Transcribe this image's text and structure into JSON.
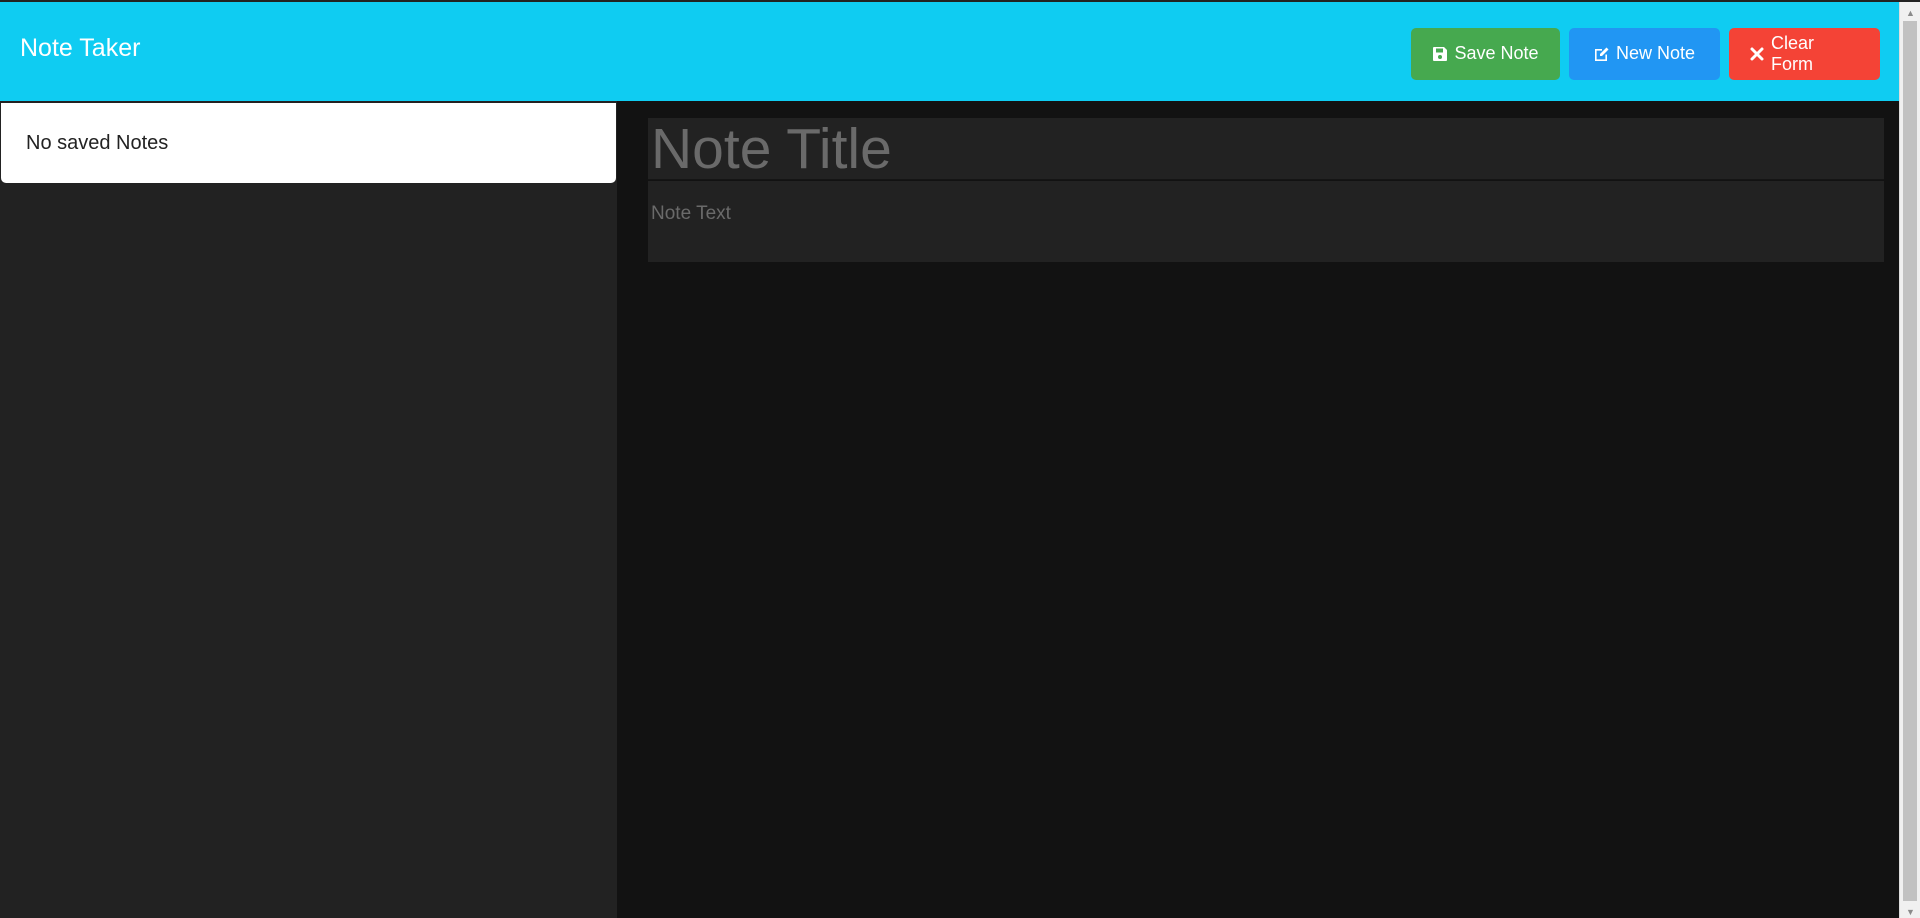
{
  "app": {
    "title": "Note Taker"
  },
  "toolbar": {
    "save_label": "Save Note",
    "new_label": "New Note",
    "clear_label": "Clear Form"
  },
  "icons": {
    "save": "floppy-disk-icon",
    "new": "edit-icon",
    "clear": "close-icon"
  },
  "sidebar": {
    "empty_message": "No saved Notes"
  },
  "editor": {
    "title_placeholder": "Note Title",
    "text_placeholder": "Note Text",
    "title_value": "",
    "text_value": ""
  },
  "colors": {
    "navbar": "#0fccf2",
    "save": "#46a94f",
    "new": "#2196f3",
    "clear": "#f44336",
    "sidebar_bg": "#222222",
    "main_bg": "#121212"
  }
}
